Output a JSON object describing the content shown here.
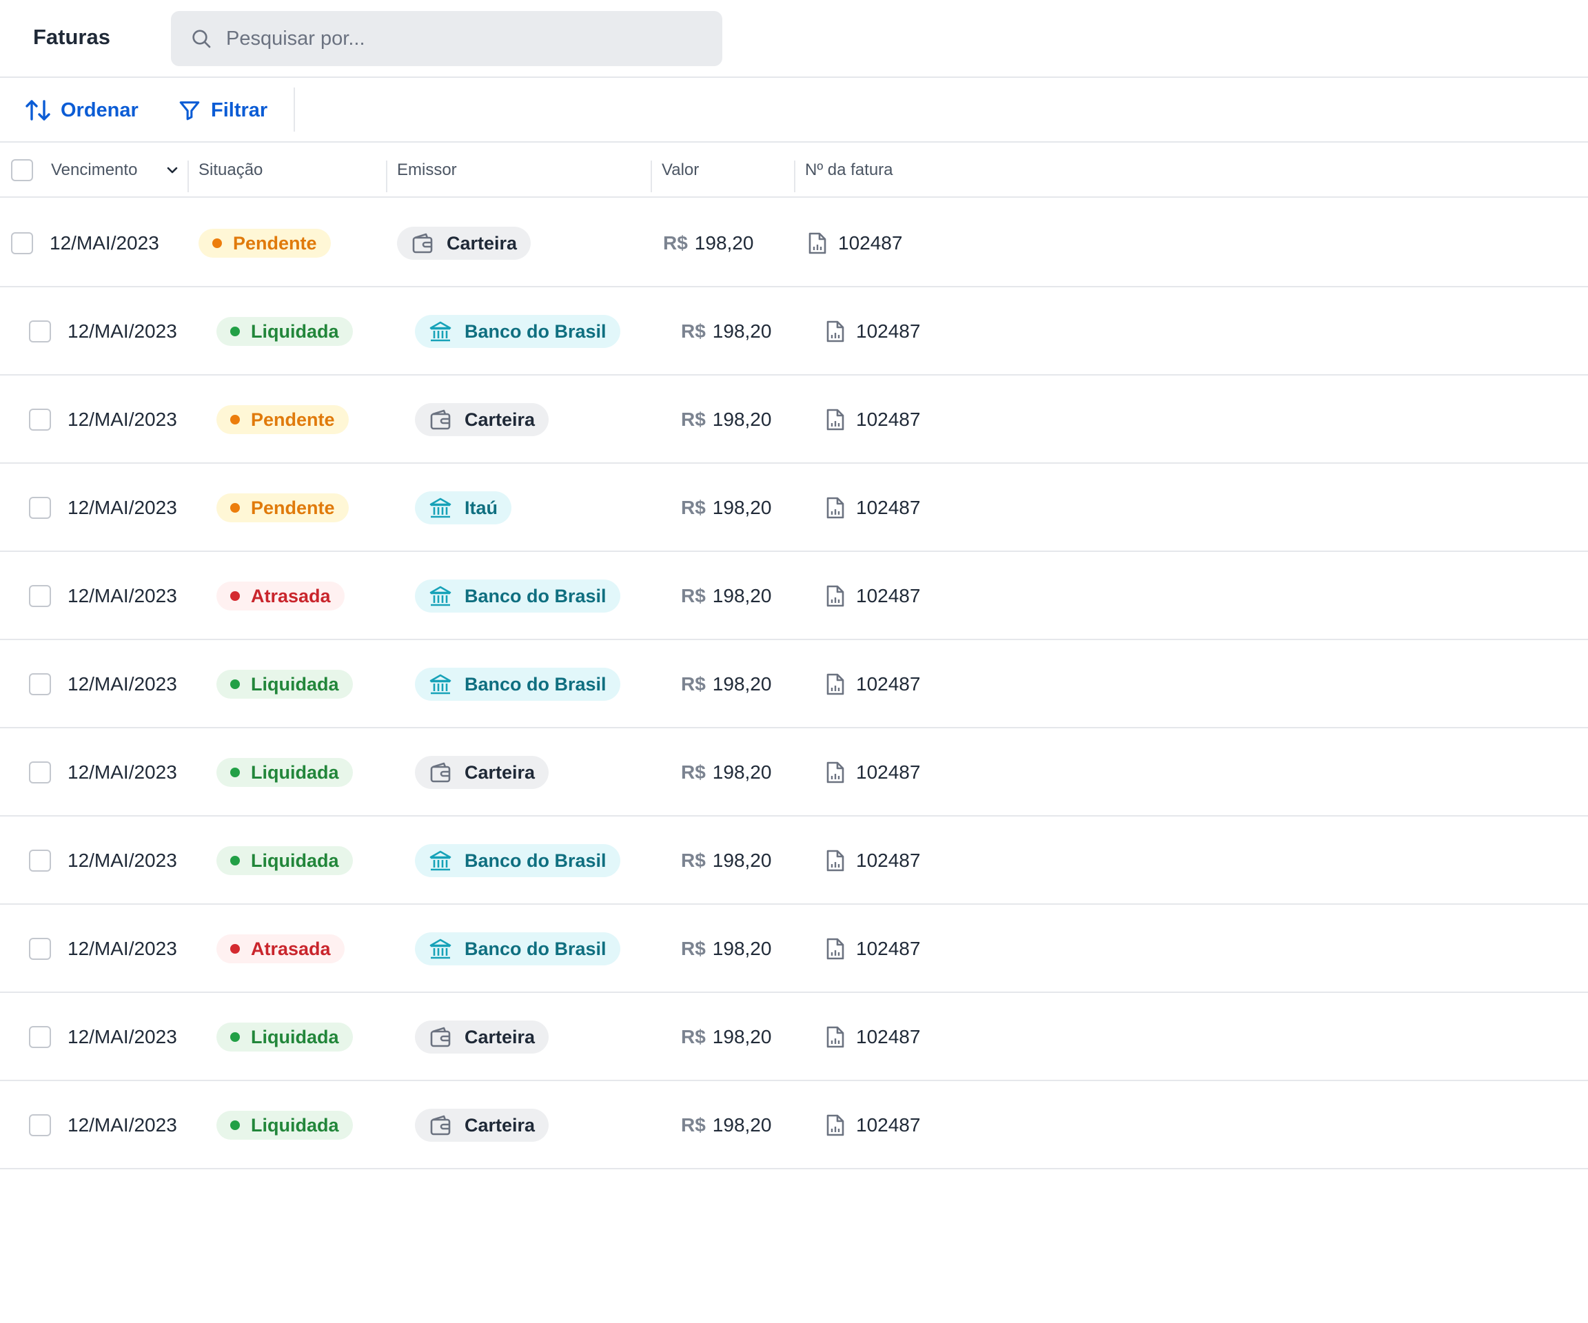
{
  "header": {
    "title": "Faturas",
    "search_placeholder": "Pesquisar por..."
  },
  "toolbar": {
    "sort_label": "Ordenar",
    "filter_label": "Filtrar"
  },
  "table": {
    "columns": {
      "vencimento": "Vencimento",
      "situacao": "Situação",
      "emissor": "Emissor",
      "valor": "Valor",
      "numero": "Nº da fatura"
    },
    "rows": [
      {
        "date": "12/MAI/2023",
        "status": "Pendente",
        "status_type": "pendente",
        "issuer": "Carteira",
        "issuer_type": "wallet",
        "currency": "R$",
        "amount": "198,20",
        "invoice": "102487"
      },
      {
        "date": "12/MAI/2023",
        "status": "Liquidada",
        "status_type": "liquidada",
        "issuer": "Banco do Brasil",
        "issuer_type": "bank",
        "currency": "R$",
        "amount": "198,20",
        "invoice": "102487"
      },
      {
        "date": "12/MAI/2023",
        "status": "Pendente",
        "status_type": "pendente",
        "issuer": "Carteira",
        "issuer_type": "wallet",
        "currency": "R$",
        "amount": "198,20",
        "invoice": "102487"
      },
      {
        "date": "12/MAI/2023",
        "status": "Pendente",
        "status_type": "pendente",
        "issuer": "Itaú",
        "issuer_type": "bank",
        "currency": "R$",
        "amount": "198,20",
        "invoice": "102487"
      },
      {
        "date": "12/MAI/2023",
        "status": "Atrasada",
        "status_type": "atrasada",
        "issuer": "Banco do Brasil",
        "issuer_type": "bank",
        "currency": "R$",
        "amount": "198,20",
        "invoice": "102487"
      },
      {
        "date": "12/MAI/2023",
        "status": "Liquidada",
        "status_type": "liquidada",
        "issuer": "Banco do Brasil",
        "issuer_type": "bank",
        "currency": "R$",
        "amount": "198,20",
        "invoice": "102487"
      },
      {
        "date": "12/MAI/2023",
        "status": "Liquidada",
        "status_type": "liquidada",
        "issuer": "Carteira",
        "issuer_type": "wallet",
        "currency": "R$",
        "amount": "198,20",
        "invoice": "102487"
      },
      {
        "date": "12/MAI/2023",
        "status": "Liquidada",
        "status_type": "liquidada",
        "issuer": "Banco do Brasil",
        "issuer_type": "bank",
        "currency": "R$",
        "amount": "198,20",
        "invoice": "102487"
      },
      {
        "date": "12/MAI/2023",
        "status": "Atrasada",
        "status_type": "atrasada",
        "issuer": "Banco do Brasil",
        "issuer_type": "bank",
        "currency": "R$",
        "amount": "198,20",
        "invoice": "102487"
      },
      {
        "date": "12/MAI/2023",
        "status": "Liquidada",
        "status_type": "liquidada",
        "issuer": "Carteira",
        "issuer_type": "wallet",
        "currency": "R$",
        "amount": "198,20",
        "invoice": "102487"
      },
      {
        "date": "12/MAI/2023",
        "status": "Liquidada",
        "status_type": "liquidada",
        "issuer": "Carteira",
        "issuer_type": "wallet",
        "currency": "R$",
        "amount": "198,20",
        "invoice": "102487"
      }
    ]
  },
  "colors": {
    "accent": "#0b5cd5",
    "pendente": "#e07a0b",
    "liquidada": "#22863a",
    "atrasada": "#c9252c",
    "bank_issuer": "#0f6f80"
  },
  "icons": {
    "search": "search-icon",
    "sort": "sort-arrows-icon",
    "filter": "filter-funnel-icon",
    "column_sort": "chevron-down-icon",
    "bank": "bank-icon",
    "wallet": "wallet-icon",
    "invoice": "invoice-document-icon"
  }
}
